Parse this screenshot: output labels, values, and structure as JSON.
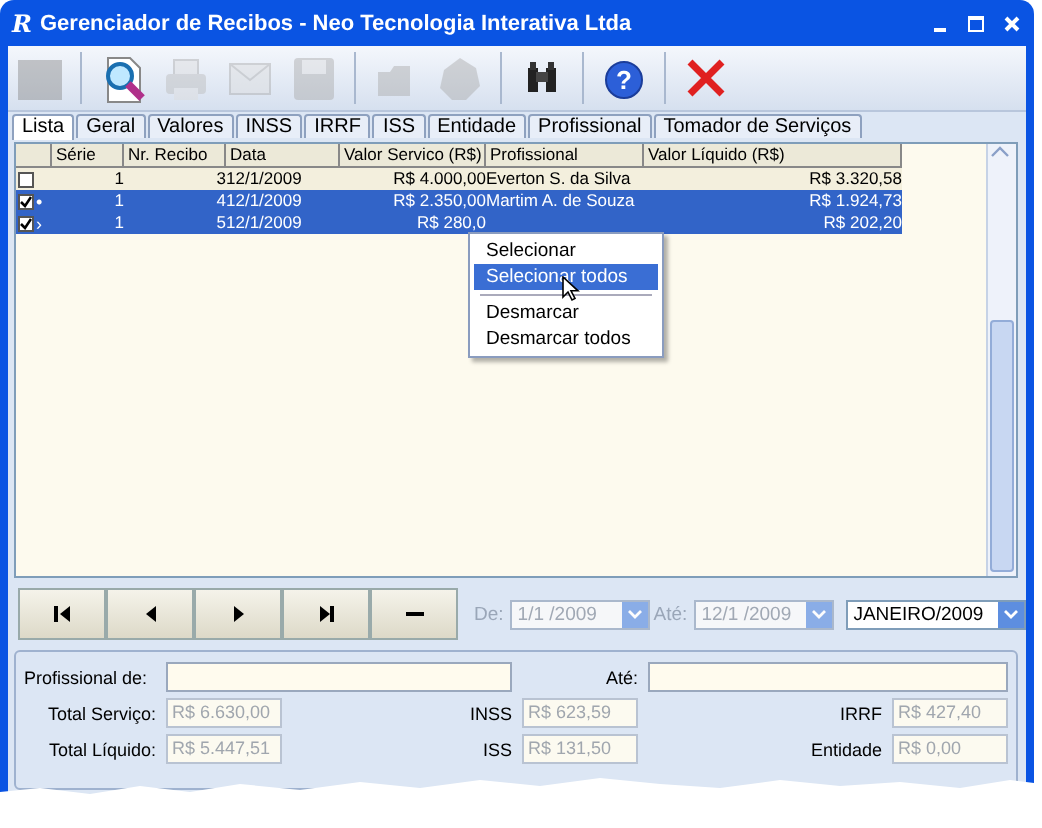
{
  "window": {
    "logo": "R",
    "title": "Gerenciador de Recibos - Neo Tecnologia Interativa Ltda"
  },
  "toolbar": {
    "buttons": [
      {
        "disabled": true
      },
      {
        "disabled": false
      },
      {
        "disabled": true
      },
      {
        "disabled": true
      },
      {
        "disabled": true
      },
      {
        "disabled": true
      },
      {
        "disabled": true
      },
      {
        "disabled": false
      },
      {
        "disabled": false,
        "label": "?"
      },
      {
        "disabled": false
      }
    ]
  },
  "tabs": [
    {
      "label": "Lista",
      "selected": true
    },
    {
      "label": "Geral",
      "selected": false
    },
    {
      "label": "Valores",
      "selected": false
    },
    {
      "label": "INSS",
      "selected": false
    },
    {
      "label": "IRRF",
      "selected": false
    },
    {
      "label": "ISS",
      "selected": false
    },
    {
      "label": "Entidade",
      "selected": false
    },
    {
      "label": "Profissional",
      "selected": false
    },
    {
      "label": "Tomador de Serviços",
      "selected": false
    }
  ],
  "table": {
    "columns": [
      "Série",
      "Nr. Recibo",
      "Data",
      "Valor Servico (R$)",
      "Profissional",
      "Valor Líquido (R$)"
    ],
    "rows": [
      {
        "checked": false,
        "selected": false,
        "cells": [
          "1",
          "3",
          "12/1/2009",
          "R$ 4.000,00",
          "Everton S. da Silva",
          "R$ 3.320,58"
        ]
      },
      {
        "checked": true,
        "selected": true,
        "indicator": "•",
        "cells": [
          "1",
          "4",
          "12/1/2009",
          "R$ 2.350,00",
          "Martim A. de Souza",
          "R$ 1.924,73"
        ]
      },
      {
        "checked": true,
        "selected": true,
        "indicator": "›",
        "cells": [
          "1",
          "5",
          "12/1/2009",
          "R$ 280,0",
          "",
          "R$ 202,20"
        ]
      }
    ]
  },
  "context_menu": {
    "items": [
      {
        "kind": "item",
        "label": "Selecionar",
        "selected": false
      },
      {
        "kind": "item",
        "label": "Selecionar todos",
        "selected": true
      },
      {
        "kind": "separator"
      },
      {
        "kind": "item",
        "label": "Desmarcar",
        "selected": false
      },
      {
        "kind": "item",
        "label": "Desmarcar todos",
        "selected": false
      }
    ]
  },
  "navigator": {
    "buttons": [
      {
        "kind": "first"
      },
      {
        "kind": "prior"
      },
      {
        "kind": "next"
      },
      {
        "kind": "last"
      },
      {
        "kind": "delete"
      }
    ],
    "from_label": "De:",
    "from_date": "1/1 /2009",
    "to_label": "Até:",
    "to_date": "12/1 /2009",
    "dates_disabled": true,
    "month": "JANEIRO/2009"
  },
  "filter": {
    "professional_from_label": "Profissional de:",
    "professional_to_label": "Até:",
    "totals": [
      {
        "label": "Total Serviço:",
        "value": "R$ 6.630,00"
      },
      {
        "label": "INSS",
        "value": "R$ 623,59"
      },
      {
        "label": "IRRF",
        "value": "R$ 427,40"
      },
      {
        "label": "Total Líquido:",
        "value": "R$ 5.447,51"
      },
      {
        "label": "ISS",
        "value": "R$ 131,50"
      },
      {
        "label": "Entidade",
        "value": "R$ 0,00"
      }
    ]
  }
}
